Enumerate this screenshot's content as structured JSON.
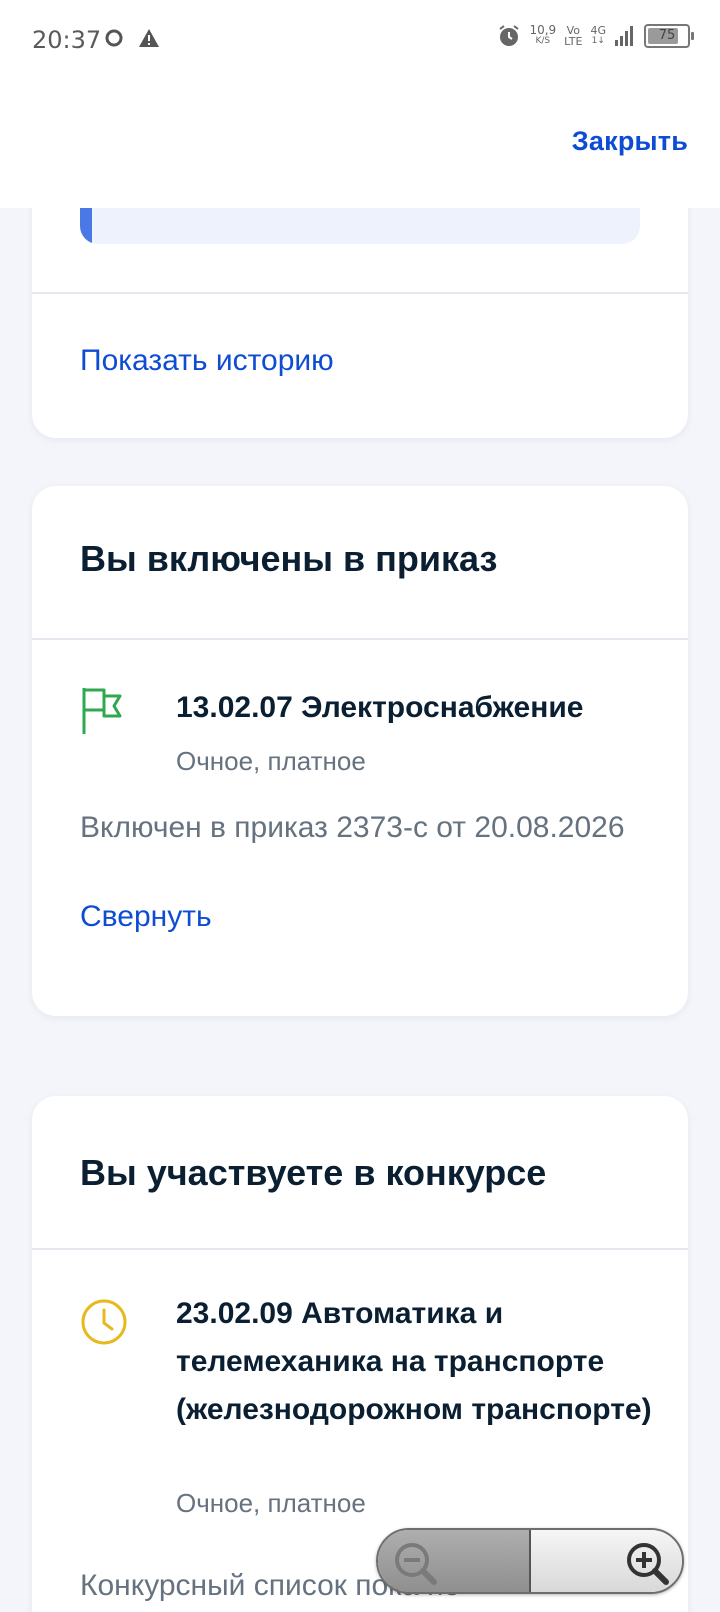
{
  "status_bar": {
    "time": "20:37",
    "speed_value": "10,9",
    "speed_unit": "K/S",
    "volte_top": "Vo",
    "volte_bottom": "LTE",
    "network": "4G",
    "battery": "75",
    "icons": [
      "chat-bubble-icon",
      "warning-icon",
      "alarm-icon",
      "signal-icon",
      "battery-icon"
    ]
  },
  "header": {
    "close_label": "Закрыть"
  },
  "history_card": {
    "show_history_label": "Показать историю"
  },
  "order_card": {
    "title": "Вы включены в приказ",
    "program_title": "13.02.07 Электроснабжение",
    "program_form": "Очное, платное",
    "order_text": "Включен в приказ 2373-с от 20.08.2026",
    "collapse_label": "Свернуть",
    "icon": "flag-icon",
    "icon_color": "#2fa84f"
  },
  "contest_card": {
    "title": "Вы участвуете в конкурсе",
    "program_title": "23.02.09 Автоматика и телемеханика на транспорте (железнодорожном транспорте)",
    "program_form": "Очное, платное",
    "contest_text": "Конкурсный список пока не",
    "icon": "clock-icon",
    "icon_color": "#e7b91e"
  },
  "zoom_control": {
    "zoom_out_icon": "zoom-out-icon",
    "zoom_in_icon": "zoom-in-icon"
  },
  "colors": {
    "link": "#0d4cd3",
    "background": "#f3f5fa",
    "text_primary": "#0b1f33",
    "text_secondary": "#66727f"
  }
}
